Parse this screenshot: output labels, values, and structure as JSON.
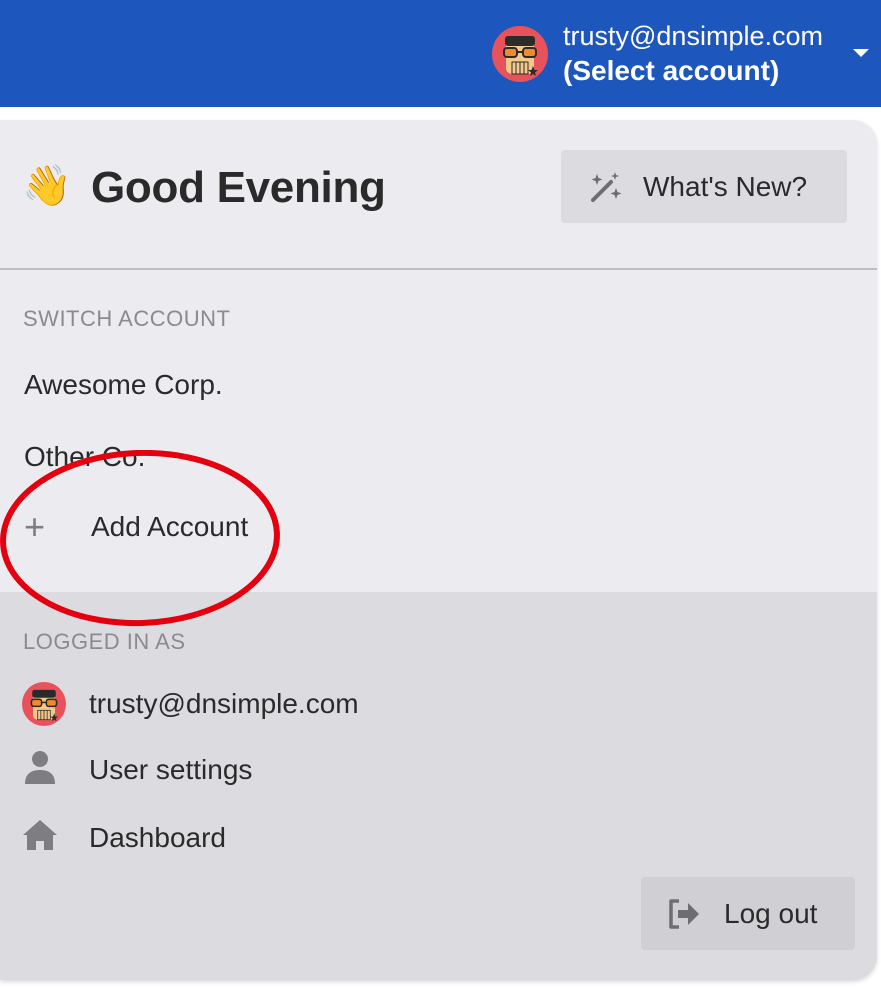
{
  "topbar": {
    "email": "trusty@dnsimple.com",
    "select_account": "(Select account)",
    "avatar_icon": "user-avatar-icon",
    "caret_icon": "caret-down-icon",
    "background_color": "#1d56bd"
  },
  "header": {
    "wave_emoji": "👋",
    "greeting": "Good Evening",
    "whats_new_label": "What's New?",
    "whats_new_icon": "magic-wand-icon"
  },
  "switch_account": {
    "heading": "SWITCH ACCOUNT",
    "accounts": [
      "Awesome Corp.",
      "Other Co."
    ],
    "add_account_label": "Add Account",
    "add_icon": "plus-icon"
  },
  "logged_in": {
    "heading": "LOGGED IN AS",
    "email": "trusty@dnsimple.com",
    "user_settings_label": "User settings",
    "dashboard_label": "Dashboard",
    "logout_label": "Log out",
    "user_icon": "user-icon",
    "home_icon": "home-icon",
    "logout_icon": "sign-out-icon"
  },
  "annotation": {
    "color": "#e3000f",
    "shape": "ellipse"
  }
}
